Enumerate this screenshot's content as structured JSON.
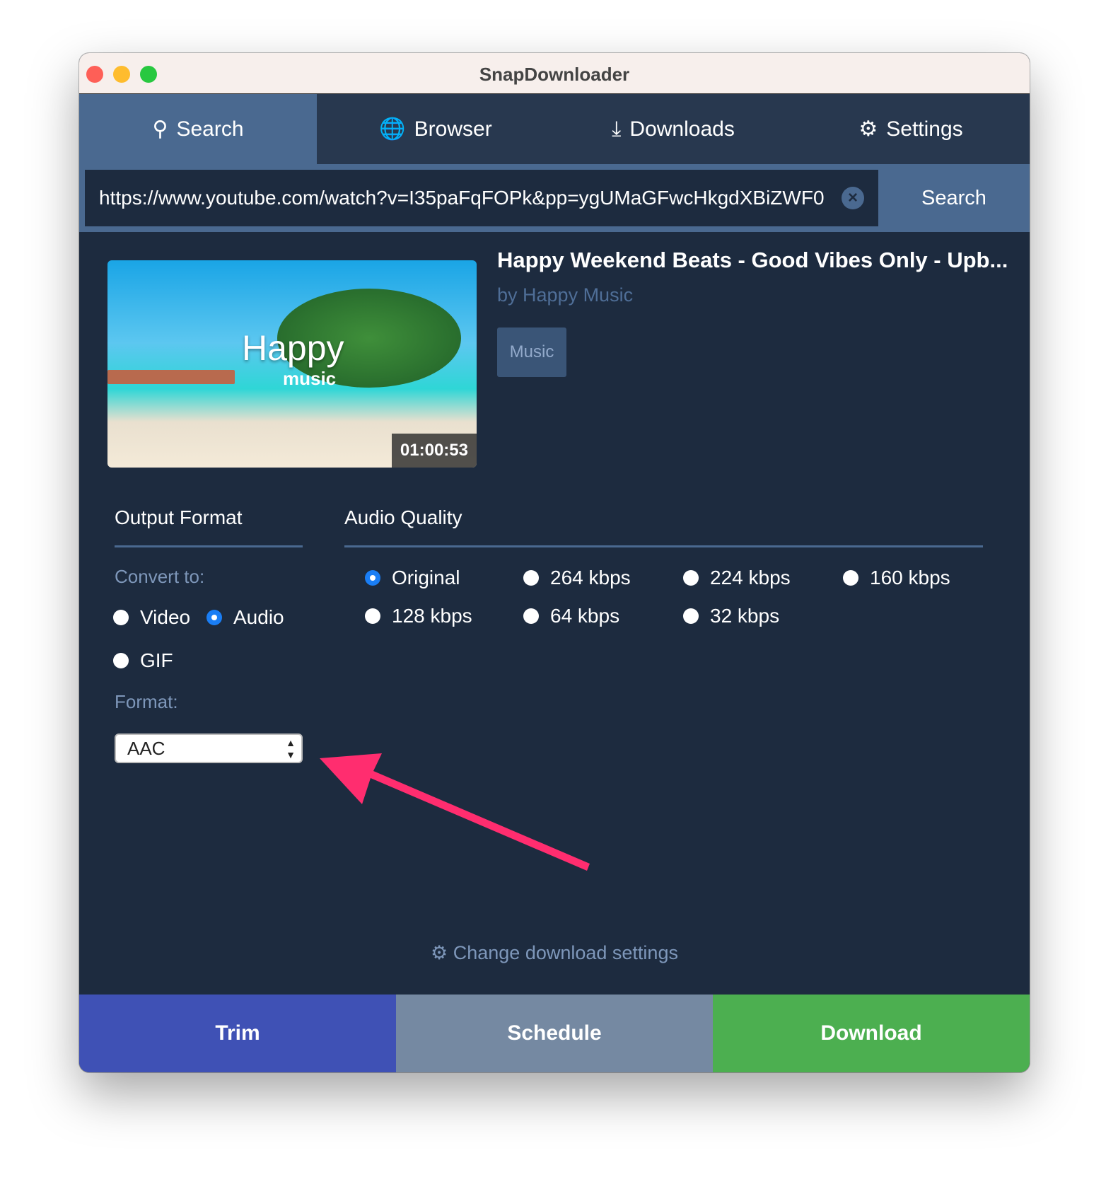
{
  "window": {
    "title": "SnapDownloader"
  },
  "tabs": [
    {
      "label": "Search",
      "icon": "search-icon",
      "active": true
    },
    {
      "label": "Browser",
      "icon": "globe-icon"
    },
    {
      "label": "Downloads",
      "icon": "download-icon"
    },
    {
      "label": "Settings",
      "icon": "gear-icon"
    }
  ],
  "search": {
    "url": "https://www.youtube.com/watch?v=I35paFqFOPk&pp=ygUMaGFwcHkgdXBiZWF0",
    "button": "Search"
  },
  "video": {
    "title": "Happy Weekend Beats - Good Vibes Only - Upb...",
    "author": "by Happy Music",
    "tag": "Music",
    "duration": "01:00:53",
    "thumb_text": "Happy",
    "thumb_subtext": "music"
  },
  "output": {
    "heading": "Output Format",
    "convert_label": "Convert to:",
    "options": [
      {
        "label": "Video",
        "selected": false
      },
      {
        "label": "Audio",
        "selected": true
      },
      {
        "label": "GIF",
        "selected": false
      }
    ],
    "format_label": "Format:",
    "format_value": "AAC"
  },
  "quality": {
    "heading": "Audio Quality",
    "options": [
      {
        "label": "Original",
        "selected": true
      },
      {
        "label": "264 kbps"
      },
      {
        "label": "224 kbps"
      },
      {
        "label": "160 kbps"
      },
      {
        "label": "128 kbps"
      },
      {
        "label": "64 kbps"
      },
      {
        "label": "32 kbps"
      }
    ]
  },
  "change_settings": "Change download settings",
  "buttons": {
    "trim": "Trim",
    "schedule": "Schedule",
    "download": "Download"
  },
  "colors": {
    "trim": "#3f51b5",
    "schedule": "#7589a2",
    "download": "#4caf50",
    "annotation_arrow": "#ff2d6f"
  }
}
